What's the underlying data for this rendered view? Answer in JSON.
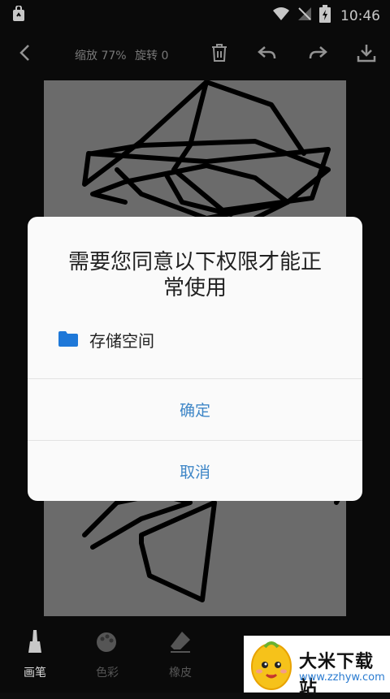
{
  "status_bar": {
    "time": "10:46"
  },
  "toolbar": {
    "zoom": "缩放 77%",
    "rotate": "旋转 0"
  },
  "dialog": {
    "title": "需要您同意以下权限才能正常使用",
    "permission": "存储空间",
    "confirm": "确定",
    "cancel": "取消",
    "accent": "#3e86c7"
  },
  "bottom_tools": [
    {
      "label": "画笔",
      "icon": "brush-icon"
    },
    {
      "label": "色彩",
      "icon": "palette-icon"
    },
    {
      "label": "橡皮",
      "icon": "eraser-icon"
    }
  ],
  "watermark": {
    "title": "大米下载站",
    "url": "www.zzhyw.com"
  }
}
